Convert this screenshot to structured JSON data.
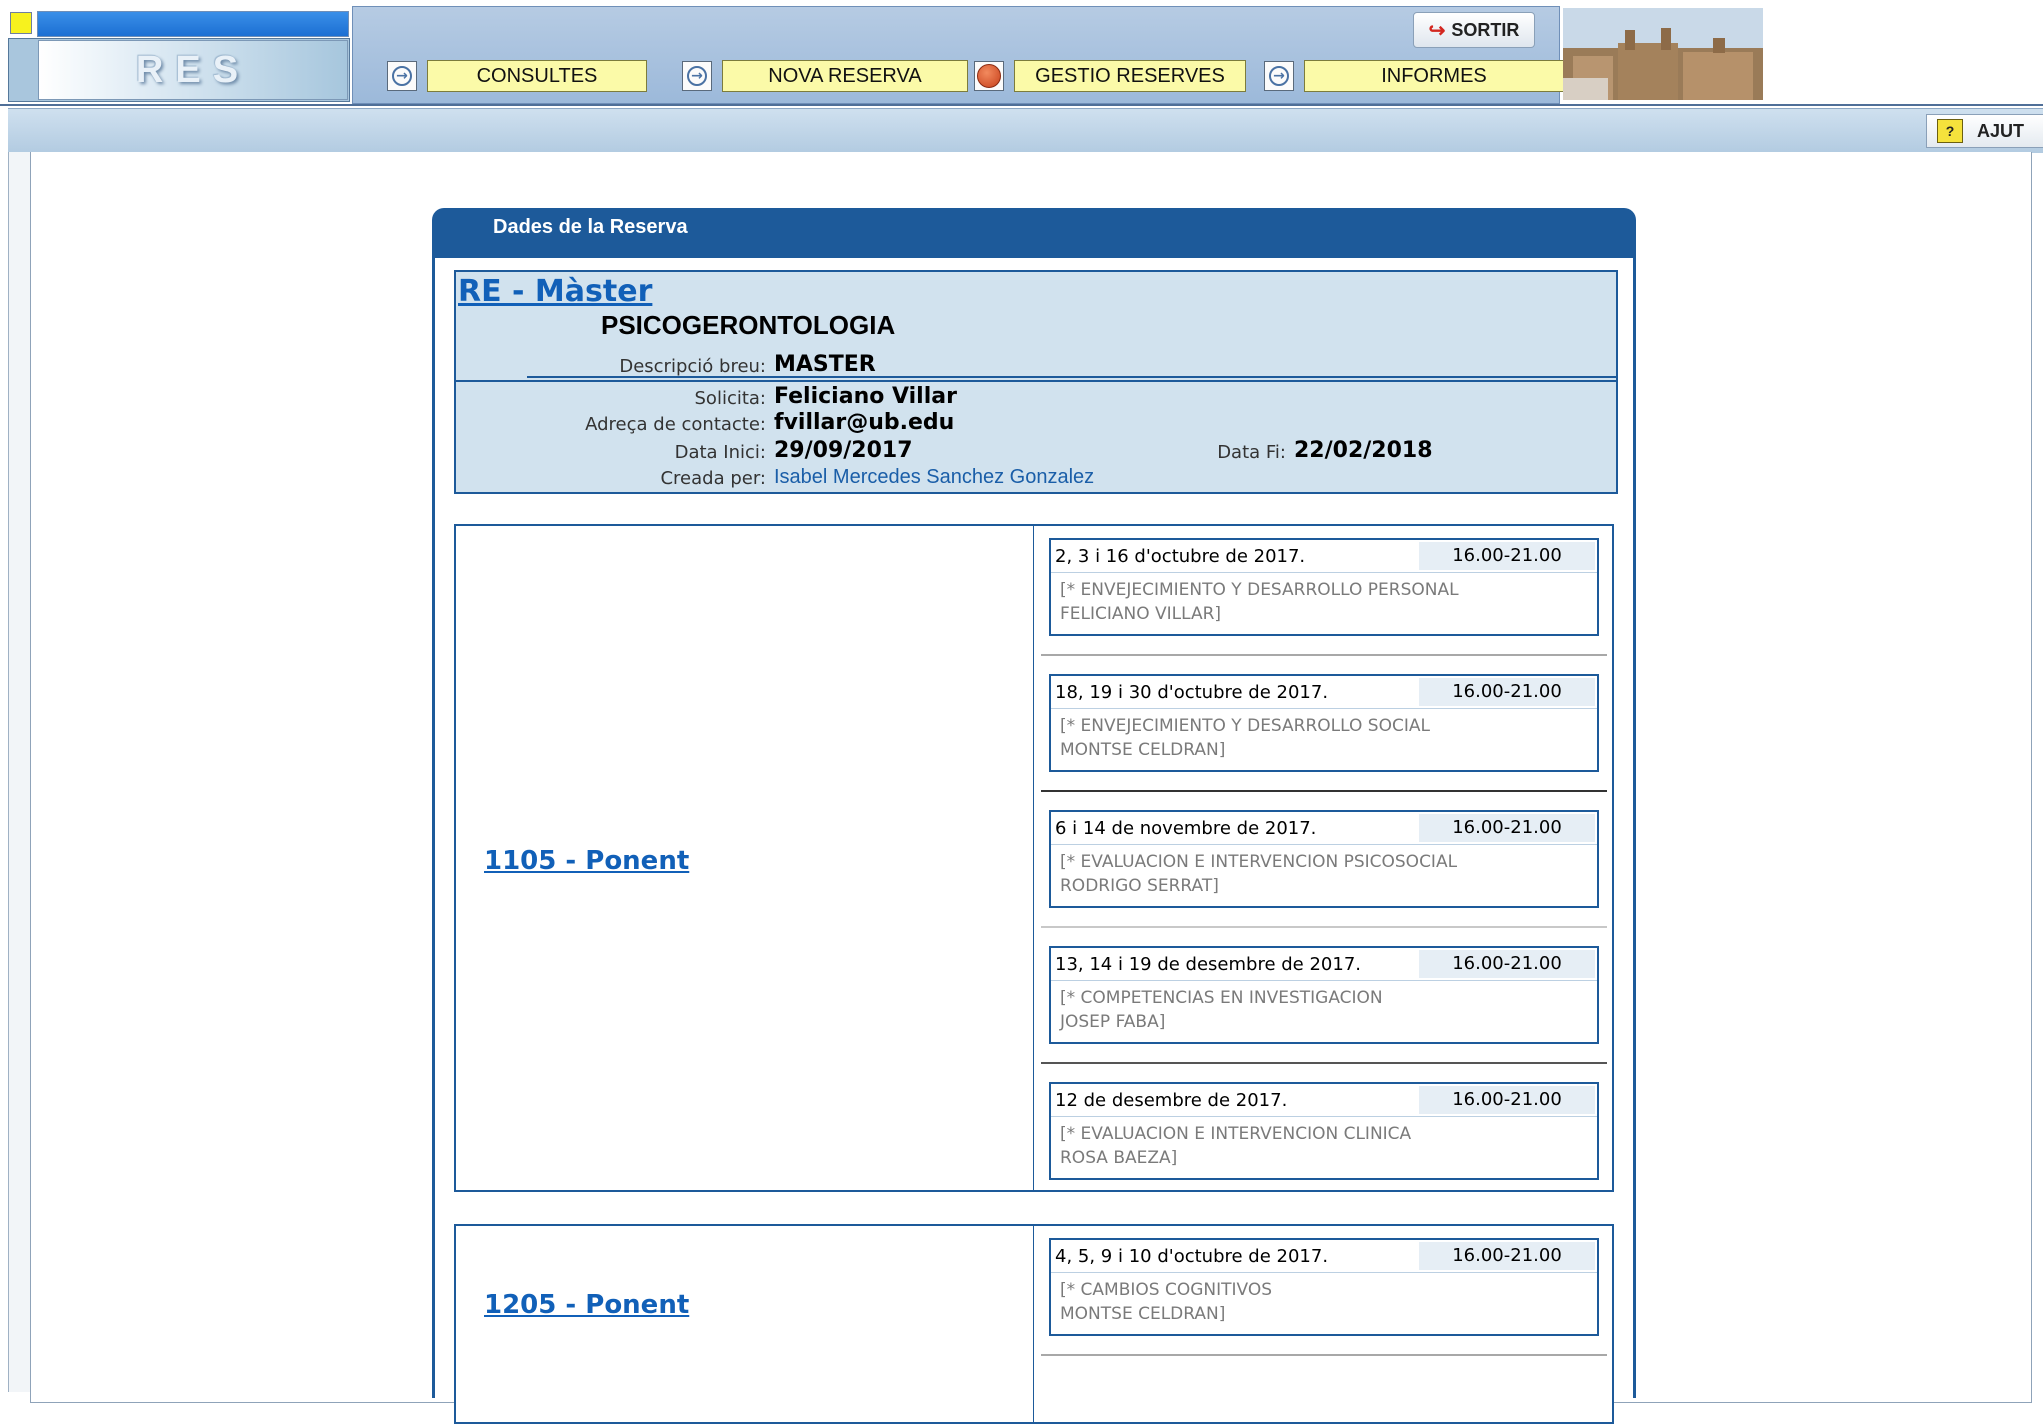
{
  "app": {
    "logo_text": "RES"
  },
  "nav": {
    "items": [
      {
        "label": "CONSULTES",
        "icon": "arrow-right-icon"
      },
      {
        "label": "NOVA RESERVA",
        "icon": "arrow-right-icon"
      },
      {
        "label": "GESTIO RESERVES",
        "icon": "red-dot-icon"
      },
      {
        "label": "INFORMES",
        "icon": "arrow-right-icon"
      }
    ],
    "sortir_label": "SORTIR",
    "ajut_label": "AJUT"
  },
  "panel": {
    "title": "Dades de la Reserva",
    "type": "RE - Màster",
    "name": "PSICOGERONTOLOGIA",
    "fields": {
      "descripcio_label": "Descripció breu:",
      "descripcio_value": "MASTER",
      "solicita_label": "Solicita:",
      "solicita_value": "Feliciano Villar",
      "adreca_label": "Adreça de contacte:",
      "adreca_value": "fvillar@ub.edu",
      "data_inici_label": "Data Inici:",
      "data_inici_value": "29/09/2017",
      "data_fi_label": "Data Fi:",
      "data_fi_value": "22/02/2018",
      "creada_label": "Creada per:",
      "creada_value": "Isabel Mercedes Sanchez Gonzalez"
    }
  },
  "rooms": [
    {
      "name": "1105 - Ponent",
      "slots": [
        {
          "dates": "2, 3 i 16 d'octubre de 2017.",
          "time": "16.00-21.00",
          "desc": "[* ENVEJECIMIENTO Y DESARROLLO PERSONAL\nFELICIANO VILLAR]"
        },
        {
          "dates": "18, 19 i 30 d'octubre de 2017.",
          "time": "16.00-21.00",
          "desc": "[* ENVEJECIMIENTO Y DESARROLLO SOCIAL\nMONTSE CELDRAN]"
        },
        {
          "dates": "6 i 14 de novembre de 2017.",
          "time": "16.00-21.00",
          "desc": "[* EVALUACION E INTERVENCION PSICOSOCIAL\nRODRIGO SERRAT]"
        },
        {
          "dates": "13, 14 i 19 de desembre de 2017.",
          "time": "16.00-21.00",
          "desc": "[* COMPETENCIAS EN INVESTIGACION\nJOSEP FABA]"
        },
        {
          "dates": "12 de desembre de 2017.",
          "time": "16.00-21.00",
          "desc": "[* EVALUACION E INTERVENCION CLINICA\nROSA BAEZA]"
        }
      ]
    },
    {
      "name": "1205 - Ponent",
      "slots": [
        {
          "dates": "4, 5, 9 i 10 d'octubre de 2017.",
          "time": "16.00-21.00",
          "desc": "[* CAMBIOS COGNITIVOS\nMONTSE CELDRAN]"
        }
      ]
    }
  ]
}
